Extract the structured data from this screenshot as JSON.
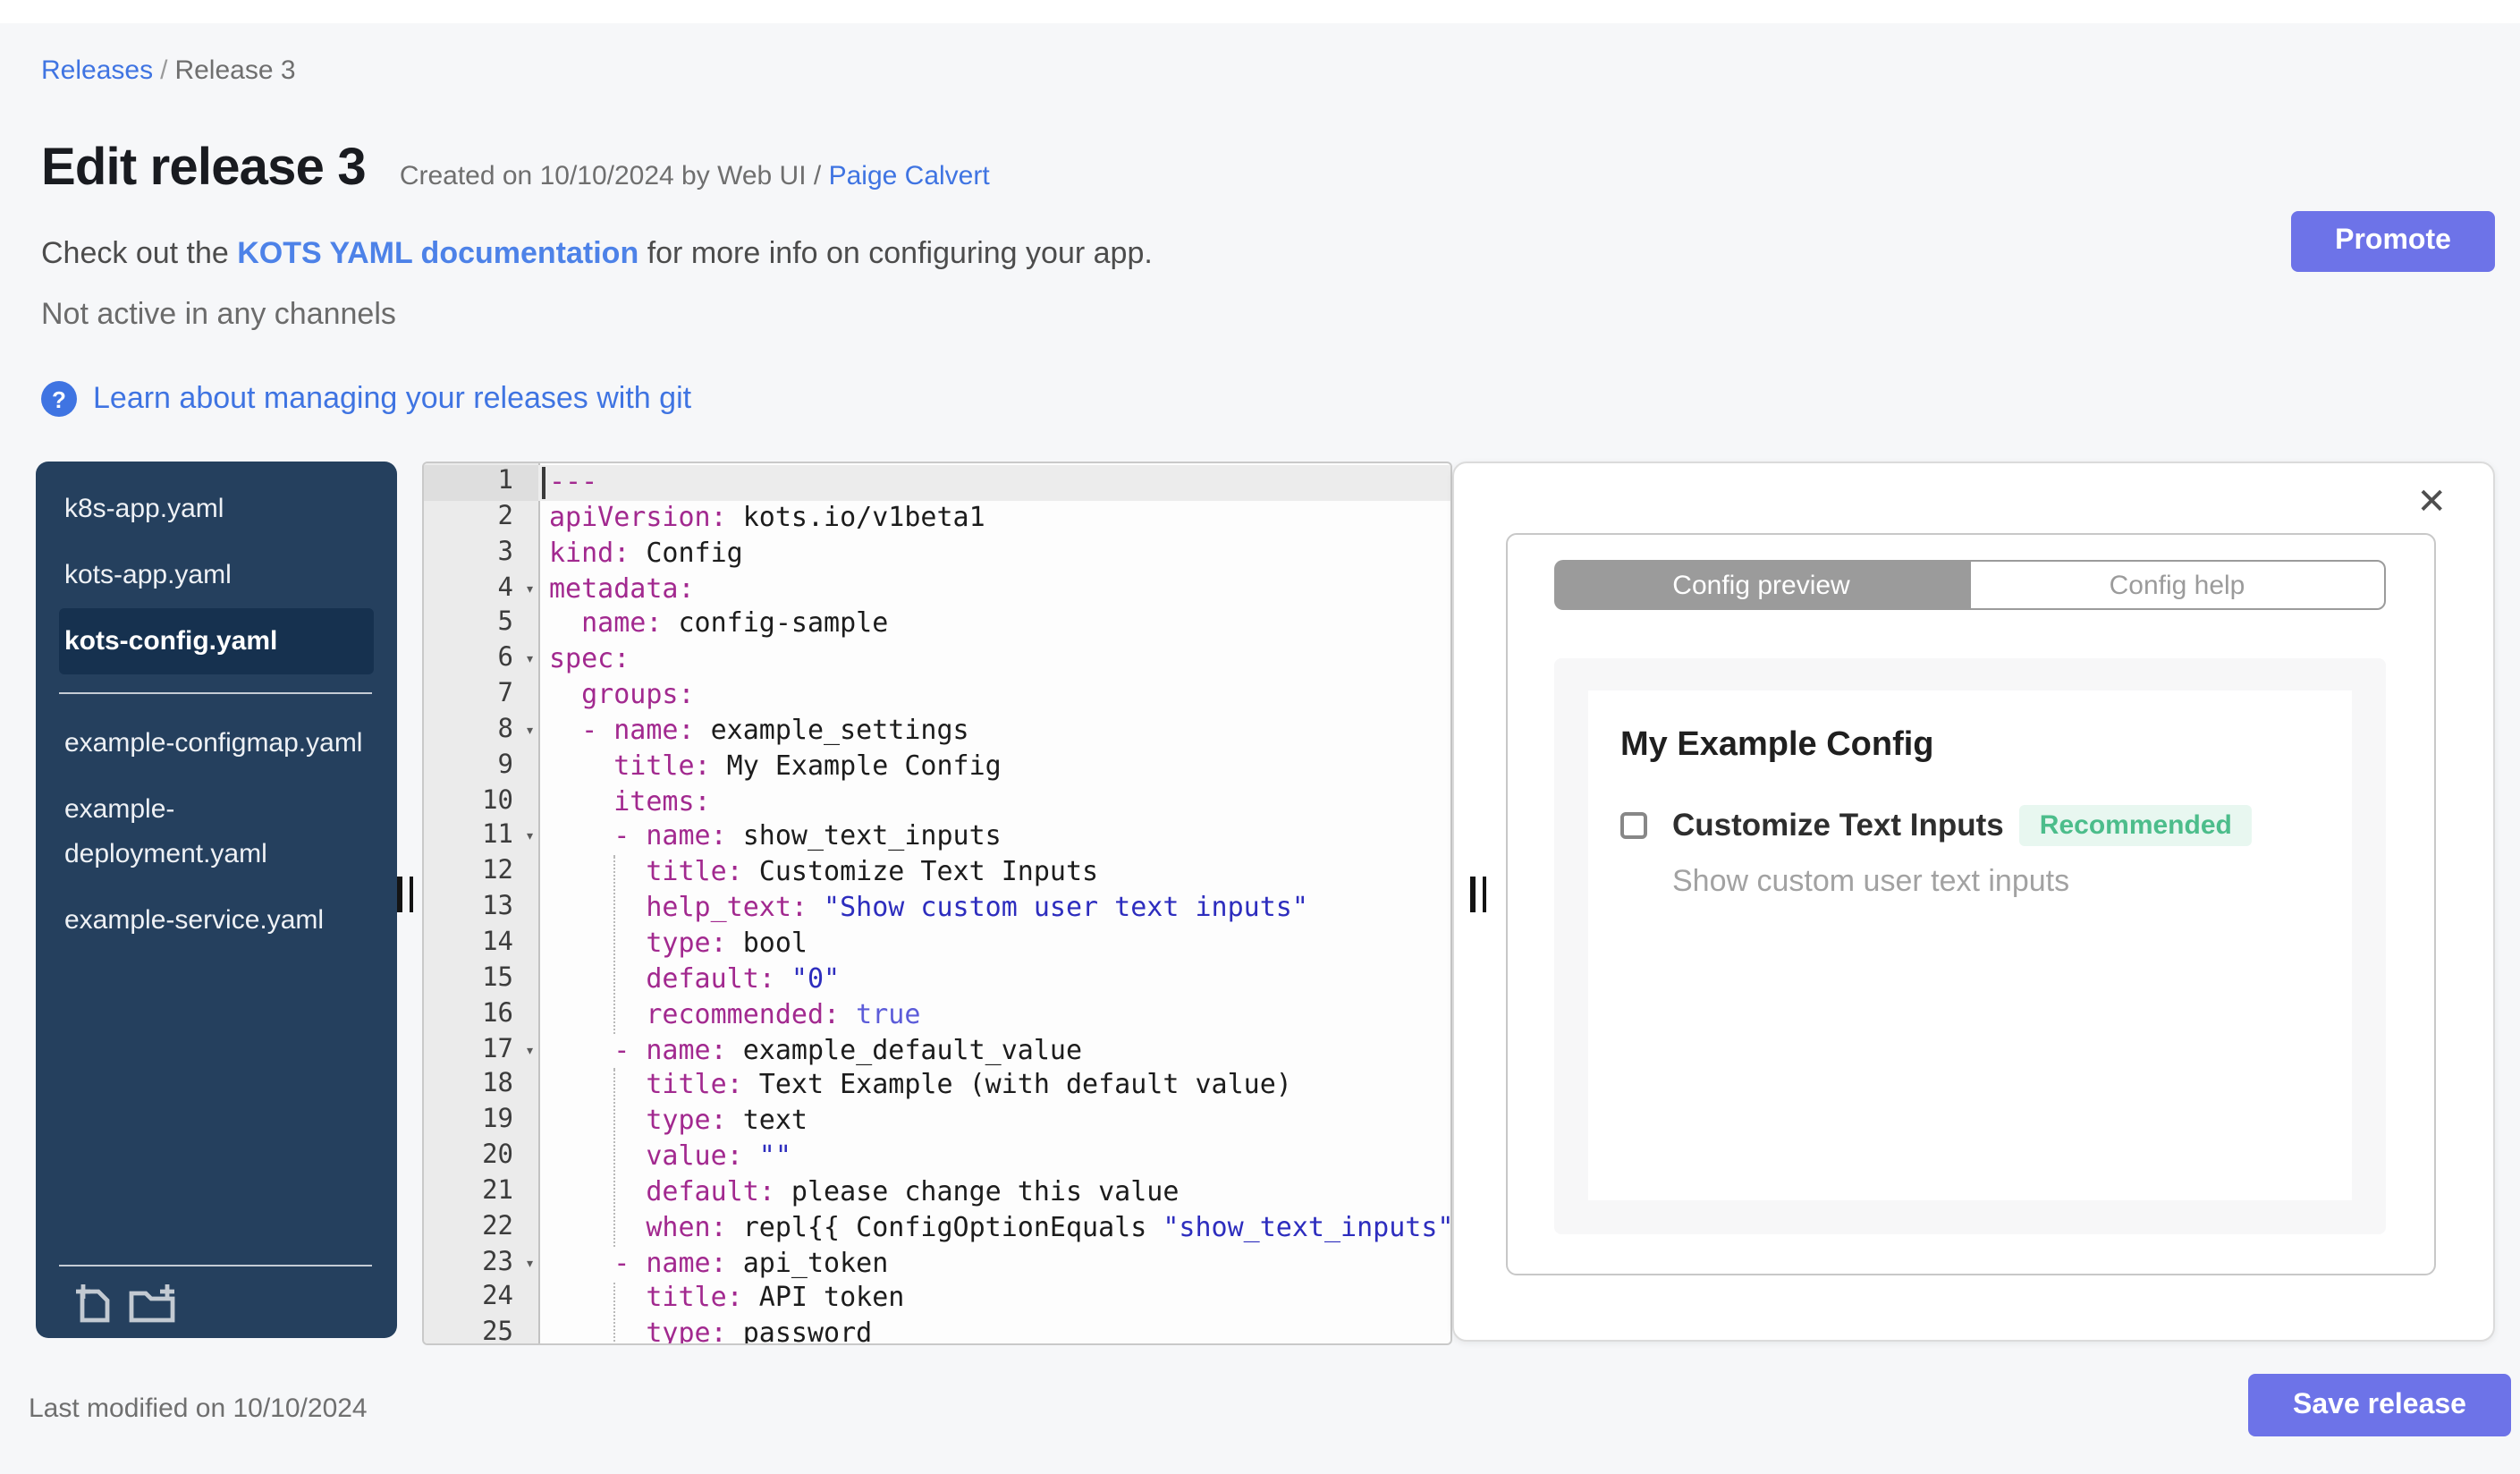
{
  "breadcrumb": {
    "link": "Releases",
    "separator": "/",
    "current": "Release 3"
  },
  "header": {
    "title": "Edit release 3",
    "created_prefix": "Created on 10/10/2024 by Web UI /",
    "created_link": "Paige Calvert",
    "promote_label": "Promote"
  },
  "info": {
    "docs_prefix": "Check out the ",
    "docs_link": "KOTS YAML documentation",
    "docs_suffix": " for more info on configuring your app.",
    "channel_status": "Not active in any channels",
    "help_icon": "?",
    "git_link": "Learn about managing your releases with git"
  },
  "file_tree": {
    "divider_after_index": 2,
    "files": [
      {
        "name": "k8s-app.yaml",
        "selected": false
      },
      {
        "name": "kots-app.yaml",
        "selected": false
      },
      {
        "name": "kots-config.yaml",
        "selected": true
      },
      {
        "name": "example-configmap.yaml",
        "selected": false
      },
      {
        "name": "example-deployment.yaml",
        "selected": false
      },
      {
        "name": "example-service.yaml",
        "selected": false
      }
    ],
    "icons": [
      {
        "name": "add-file"
      },
      {
        "name": "add-folder"
      }
    ]
  },
  "editor": {
    "indent_guides": [
      {
        "from": 12,
        "to": 16
      },
      {
        "from": 18,
        "to": 22
      },
      {
        "from": 24,
        "to": 25
      }
    ],
    "lines": [
      {
        "n": 1,
        "a": true,
        "caret": true,
        "t": [
          [
            "k",
            "---"
          ]
        ]
      },
      {
        "n": 2,
        "t": [
          [
            "k",
            "apiVersion:"
          ],
          [
            "p",
            " kots.io/v1beta1"
          ]
        ]
      },
      {
        "n": 3,
        "t": [
          [
            "k",
            "kind:"
          ],
          [
            "p",
            " Config"
          ]
        ]
      },
      {
        "n": 4,
        "f": true,
        "t": [
          [
            "k",
            "metadata:"
          ]
        ]
      },
      {
        "n": 5,
        "t": [
          [
            "p",
            "  "
          ],
          [
            "k",
            "name:"
          ],
          [
            "p",
            " config-sample"
          ]
        ]
      },
      {
        "n": 6,
        "f": true,
        "t": [
          [
            "k",
            "spec:"
          ]
        ]
      },
      {
        "n": 7,
        "t": [
          [
            "p",
            "  "
          ],
          [
            "k",
            "groups:"
          ]
        ]
      },
      {
        "n": 8,
        "f": true,
        "t": [
          [
            "p",
            "  "
          ],
          [
            "k",
            "- name:"
          ],
          [
            "p",
            " example_settings"
          ]
        ]
      },
      {
        "n": 9,
        "t": [
          [
            "p",
            "    "
          ],
          [
            "k",
            "title:"
          ],
          [
            "p",
            " My Example Config"
          ]
        ]
      },
      {
        "n": 10,
        "t": [
          [
            "p",
            "    "
          ],
          [
            "k",
            "items:"
          ]
        ]
      },
      {
        "n": 11,
        "f": true,
        "t": [
          [
            "p",
            "    "
          ],
          [
            "k",
            "- name:"
          ],
          [
            "p",
            " show_text_inputs"
          ]
        ]
      },
      {
        "n": 12,
        "t": [
          [
            "p",
            "      "
          ],
          [
            "k",
            "title:"
          ],
          [
            "p",
            " Customize Text Inputs"
          ]
        ]
      },
      {
        "n": 13,
        "t": [
          [
            "p",
            "      "
          ],
          [
            "k",
            "help_text:"
          ],
          [
            "s",
            " \"Show custom user text inputs\""
          ]
        ]
      },
      {
        "n": 14,
        "t": [
          [
            "p",
            "      "
          ],
          [
            "k",
            "type:"
          ],
          [
            "p",
            " bool"
          ]
        ]
      },
      {
        "n": 15,
        "t": [
          [
            "p",
            "      "
          ],
          [
            "k",
            "default:"
          ],
          [
            "s",
            " \"0\""
          ]
        ]
      },
      {
        "n": 16,
        "t": [
          [
            "p",
            "      "
          ],
          [
            "k",
            "recommended:"
          ],
          [
            "b",
            " true"
          ]
        ]
      },
      {
        "n": 17,
        "f": true,
        "t": [
          [
            "p",
            "    "
          ],
          [
            "k",
            "- name:"
          ],
          [
            "p",
            " example_default_value"
          ]
        ]
      },
      {
        "n": 18,
        "t": [
          [
            "p",
            "      "
          ],
          [
            "k",
            "title:"
          ],
          [
            "p",
            " Text Example (with default value)"
          ]
        ]
      },
      {
        "n": 19,
        "t": [
          [
            "p",
            "      "
          ],
          [
            "k",
            "type:"
          ],
          [
            "p",
            " text"
          ]
        ]
      },
      {
        "n": 20,
        "t": [
          [
            "p",
            "      "
          ],
          [
            "k",
            "value:"
          ],
          [
            "s",
            " \"\""
          ]
        ]
      },
      {
        "n": 21,
        "t": [
          [
            "p",
            "      "
          ],
          [
            "k",
            "default:"
          ],
          [
            "p",
            " please change this value"
          ]
        ]
      },
      {
        "n": 22,
        "t": [
          [
            "p",
            "      "
          ],
          [
            "k",
            "when:"
          ],
          [
            "p",
            " repl{{ ConfigOptionEquals "
          ],
          [
            "s",
            "\"show_text_inputs\""
          ]
        ]
      },
      {
        "n": 23,
        "f": true,
        "t": [
          [
            "p",
            "    "
          ],
          [
            "k",
            "- name:"
          ],
          [
            "p",
            " api_token"
          ]
        ]
      },
      {
        "n": 24,
        "t": [
          [
            "p",
            "      "
          ],
          [
            "k",
            "title:"
          ],
          [
            "p",
            " API token"
          ]
        ]
      },
      {
        "n": 25,
        "t": [
          [
            "p",
            "      "
          ],
          [
            "k",
            "type:"
          ],
          [
            "p",
            " password"
          ]
        ]
      }
    ]
  },
  "preview_panel": {
    "close_icon": "✕",
    "tabs": [
      {
        "label": "Config preview",
        "active": true
      },
      {
        "label": "Config help",
        "active": false
      }
    ],
    "config": {
      "group_title": "My Example Config",
      "item_label": "Customize Text Inputs",
      "checkbox_checked": false,
      "badge": "Recommended",
      "help_text": "Show custom user text inputs"
    }
  },
  "footer": {
    "last_modified": "Last modified on 10/10/2024",
    "save_label": "Save release"
  },
  "colors": {
    "accent": "#6d73e8",
    "link": "#3f74e2",
    "page_bg": "#f6f7f9",
    "sidebar_bg": "#25405e",
    "sidebar_selected_bg": "#16314f",
    "tab_selected_bg": "#9b9b9b",
    "badge_text": "#4cbd8b",
    "badge_bg": "#e8f7f0",
    "code_key": "#a2298f",
    "code_string": "#2d2dbe",
    "code_bool": "#5c5cd9",
    "code_plain": "#1c1c1c"
  }
}
